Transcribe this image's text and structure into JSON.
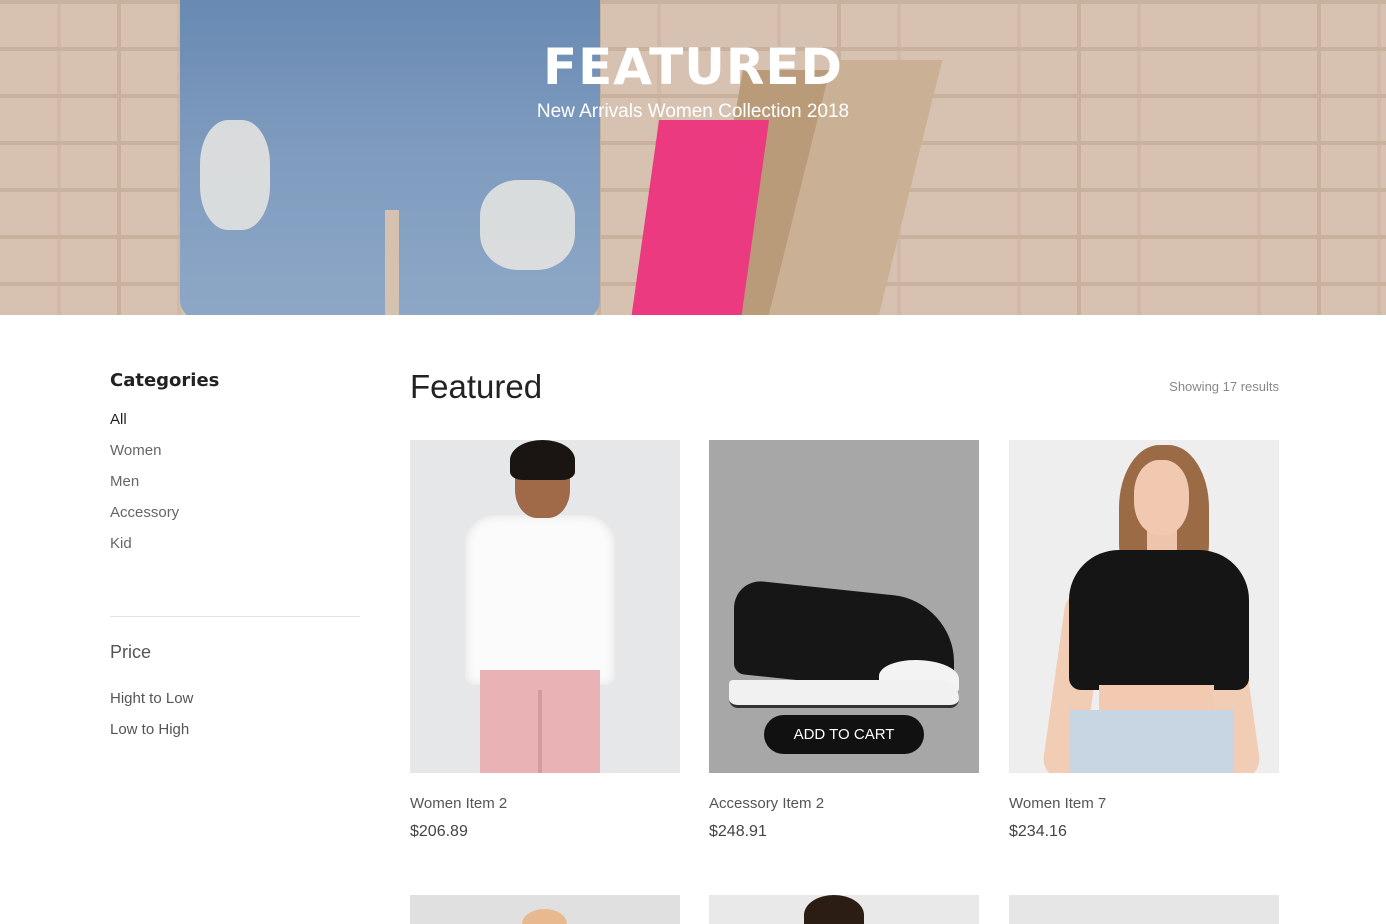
{
  "hero": {
    "title": "FEATURED",
    "subtitle": "New Arrivals Women Collection 2018"
  },
  "sidebar": {
    "categories_title": "Categories",
    "categories": [
      {
        "label": "All",
        "active": true
      },
      {
        "label": "Women",
        "active": false
      },
      {
        "label": "Men",
        "active": false
      },
      {
        "label": "Accessory",
        "active": false
      },
      {
        "label": "Kid",
        "active": false
      }
    ],
    "price_title": "Price",
    "price_options": [
      "Hight to Low",
      "Low to High"
    ]
  },
  "main": {
    "title": "Featured",
    "results_text": "Showing 17 results",
    "products": [
      {
        "name": "Women Item 2",
        "price": "$206.89"
      },
      {
        "name": "Accessory Item 2",
        "price": "$248.91",
        "button": "ADD TO CART"
      },
      {
        "name": "Women Item 7",
        "price": "$234.16"
      }
    ]
  }
}
